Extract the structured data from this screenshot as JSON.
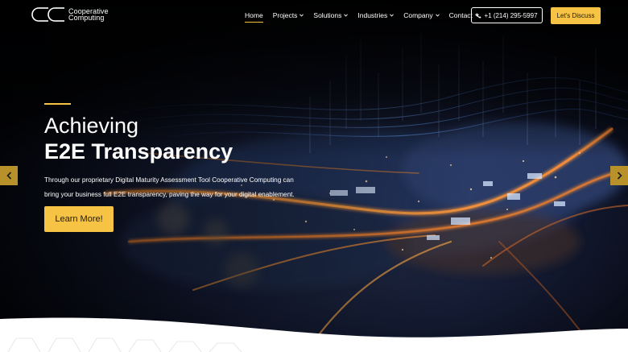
{
  "brand": {
    "logo_mark": "CC",
    "name_line1": "Cooperative",
    "name_line2": "Computing"
  },
  "nav": {
    "items": [
      {
        "label": "Home",
        "has_dropdown": false,
        "active": true
      },
      {
        "label": "Projects",
        "has_dropdown": true
      },
      {
        "label": "Solutions",
        "has_dropdown": true
      },
      {
        "label": "Industries",
        "has_dropdown": true
      },
      {
        "label": "Company",
        "has_dropdown": true
      },
      {
        "label": "Contact",
        "has_dropdown": true
      }
    ],
    "phone": "+1 (214) 295-5997",
    "phone_icon": "phone-icon",
    "cta": "Let's Discuss"
  },
  "hero": {
    "title_line1": "Achieving",
    "title_line2": "E2E Transparency",
    "description_line1": "Through our proprietary Digital Maturity Assessment Tool Cooperative Computing can",
    "description_line2": "bring your business full E2E transparency, paving the way for your digital enablement.",
    "button": "Learn More!",
    "prev_icon": "chevron-left-icon",
    "next_icon": "chevron-right-icon"
  },
  "colors": {
    "accent": "#f6c344",
    "arrow_bg": "#b8912a",
    "text": "#ffffff"
  }
}
